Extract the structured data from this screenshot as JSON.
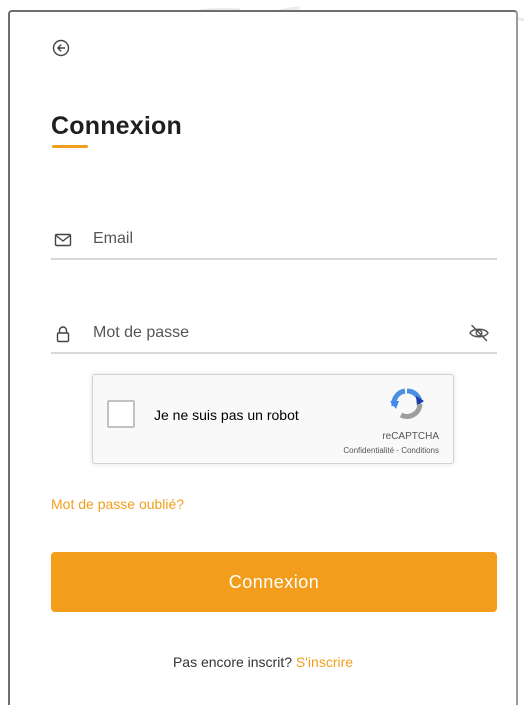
{
  "login": {
    "title": "Connexion",
    "email_placeholder": "Email",
    "password_placeholder": "Mot de passe",
    "forgot_password": "Mot de passe oublié?",
    "submit_label": "Connexion"
  },
  "recaptcha": {
    "label": "Je ne suis pas un robot",
    "brand": "reCAPTCHA",
    "privacy": "Confidentialité",
    "separator": " - ",
    "terms": "Conditions"
  },
  "signup": {
    "prompt": "Pas encore inscrit?",
    "link": "S'inscrire"
  },
  "icons": {
    "back": "circle-arrow-left-icon",
    "email": "envelope-icon",
    "password": "lock-icon",
    "visibility": "eye-slash-icon",
    "recaptcha": "recaptcha-logo-icon"
  },
  "colors": {
    "accent": "#f29e1c",
    "title": "#1f1f1f",
    "field_border": "#d9d9d9"
  }
}
